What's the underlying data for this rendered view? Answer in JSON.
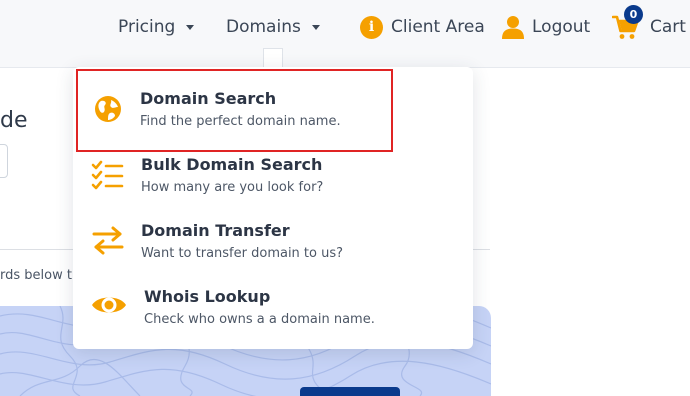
{
  "nav": {
    "pricing_label": "Pricing",
    "domains_label": "Domains",
    "client_area_label": "Client Area",
    "logout_label": "Logout",
    "cart_label": "Cart",
    "cart_count": "0",
    "info_glyph": "i",
    "icons": {
      "pricing_caret": "chevron-down-icon",
      "domains_caret": "chevron-down-icon",
      "client_area": "info-icon",
      "logout": "user-icon",
      "cart": "shopping-cart-icon"
    }
  },
  "page": {
    "heading_fragment": "de",
    "hint_fragment": "rds below t"
  },
  "dropdown": {
    "items": [
      {
        "title": "Domain Search",
        "subtitle": "Find the perfect domain name.",
        "icon": "globe-icon"
      },
      {
        "title": "Bulk Domain Search",
        "subtitle": "How many are you look for?",
        "icon": "checklist-icon"
      },
      {
        "title": "Domain Transfer",
        "subtitle": "Want to transfer domain to us?",
        "icon": "transfer-arrows-icon"
      },
      {
        "title": "Whois Lookup",
        "subtitle": "Check who owns a a domain name.",
        "icon": "eye-icon"
      }
    ]
  },
  "colors": {
    "accent": "#f5a000",
    "brand_dark": "#0a3a8c",
    "highlight": "#e02424",
    "map_panel": "#c6d3f6"
  }
}
